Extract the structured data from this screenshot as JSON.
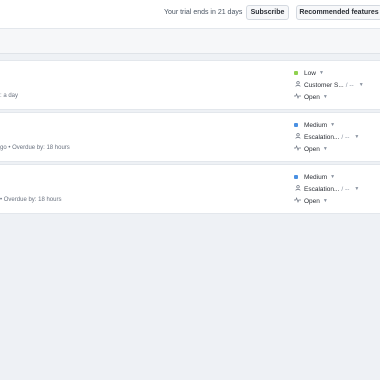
{
  "header": {
    "trial_text": "Your trial ends in 21 days",
    "subscribe_label": "Subscribe",
    "recommended_label": "Recommended features"
  },
  "colors": {
    "low": "#8fd14f",
    "medium": "#4a90e2"
  },
  "icons": {
    "assignee": "person-icon",
    "status": "activity-icon",
    "dropdown": "chevron-down-icon"
  },
  "tickets": [
    {
      "meta": ": a day",
      "priority": "Low",
      "assignee": "Customer S...",
      "assignee_extra": "/ --",
      "status": "Open"
    },
    {
      "meta": "go • Overdue by: 18 hours",
      "priority": "Medium",
      "assignee": "Escalation...",
      "assignee_extra": "/ --",
      "status": "Open"
    },
    {
      "meta": "• Overdue by: 18 hours",
      "priority": "Medium",
      "assignee": "Escalation...",
      "assignee_extra": "/ --",
      "status": "Open"
    }
  ]
}
